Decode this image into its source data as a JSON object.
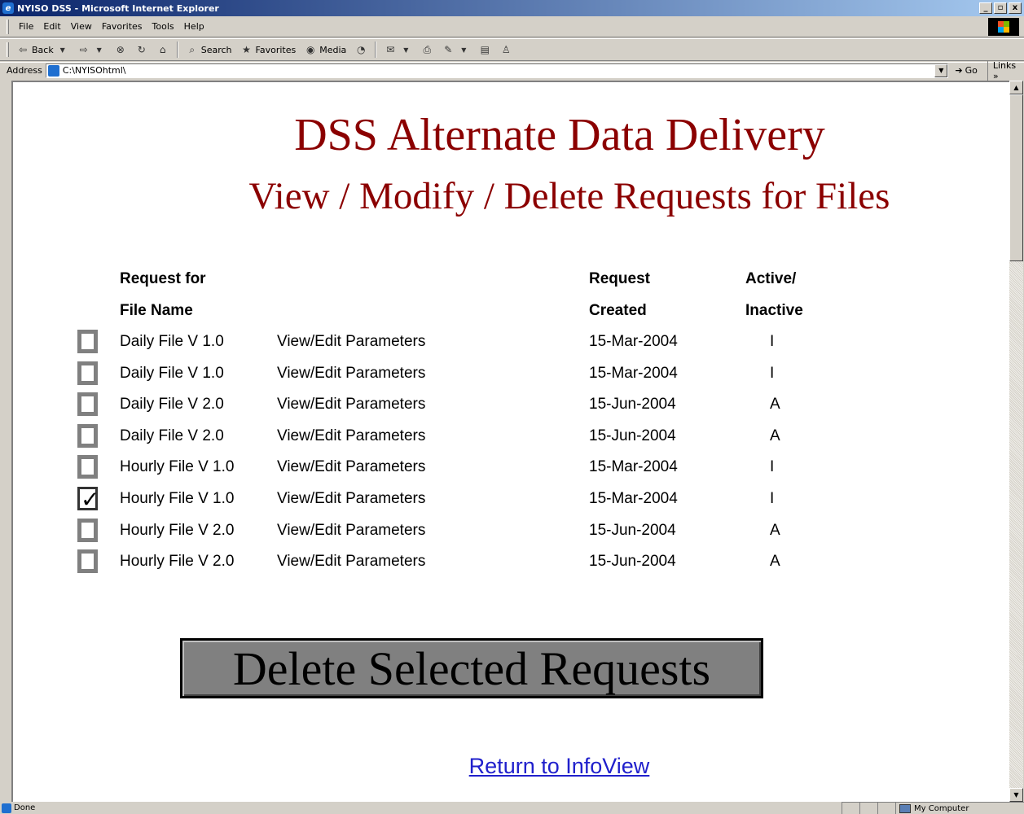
{
  "window": {
    "title": "NYISO DSS - Microsoft Internet Explorer",
    "buttons": [
      "_",
      "▫",
      "x"
    ]
  },
  "menu": {
    "items": [
      "File",
      "Edit",
      "View",
      "Favorites",
      "Tools",
      "Help"
    ]
  },
  "toolbar": {
    "back_label": "Back",
    "search_label": "Search",
    "favorites_label": "Favorites",
    "media_label": "Media"
  },
  "address": {
    "label": "Address",
    "value": "C:\\NYISOhtml\\",
    "go_label": "Go",
    "links_label": "Links"
  },
  "page": {
    "title": "DSS Alternate Data Delivery",
    "subtitle": "View / Modify / Delete Requests for Files",
    "headers": {
      "request_for": "Request for",
      "file_name": "File Name",
      "request": "Request",
      "created": "Created",
      "active": "Active/",
      "inactive": "Inactive"
    },
    "rows": [
      {
        "file": "Daily File V 1.0",
        "link": "View/Edit Parameters",
        "created": "15-Mar-2004",
        "status": "I",
        "checked": false
      },
      {
        "file": "Daily File V 1.0",
        "link": "View/Edit Parameters",
        "created": "15-Mar-2004",
        "status": "I",
        "checked": false
      },
      {
        "file": "Daily File V 2.0",
        "link": "View/Edit Parameters",
        "created": "15-Jun-2004",
        "status": "A",
        "checked": false
      },
      {
        "file": "Daily File V 2.0",
        "link": "View/Edit Parameters",
        "created": "15-Jun-2004",
        "status": "A",
        "checked": false
      },
      {
        "file": "Hourly File V 1.0",
        "link": "View/Edit Parameters",
        "created": "15-Mar-2004",
        "status": "I",
        "checked": false
      },
      {
        "file": "Hourly File V 1.0",
        "link": "View/Edit Parameters",
        "created": "15-Mar-2004",
        "status": "I",
        "checked": true
      },
      {
        "file": "Hourly File V 2.0",
        "link": "View/Edit Parameters",
        "created": "15-Jun-2004",
        "status": "A",
        "checked": false
      },
      {
        "file": "Hourly File V 2.0",
        "link": "View/Edit Parameters",
        "created": "15-Jun-2004",
        "status": "A",
        "checked": false
      }
    ],
    "delete_button": "Delete Selected Requests",
    "return_link": "Return to InfoView"
  },
  "status": {
    "text": "Done",
    "zone": "My Computer"
  }
}
